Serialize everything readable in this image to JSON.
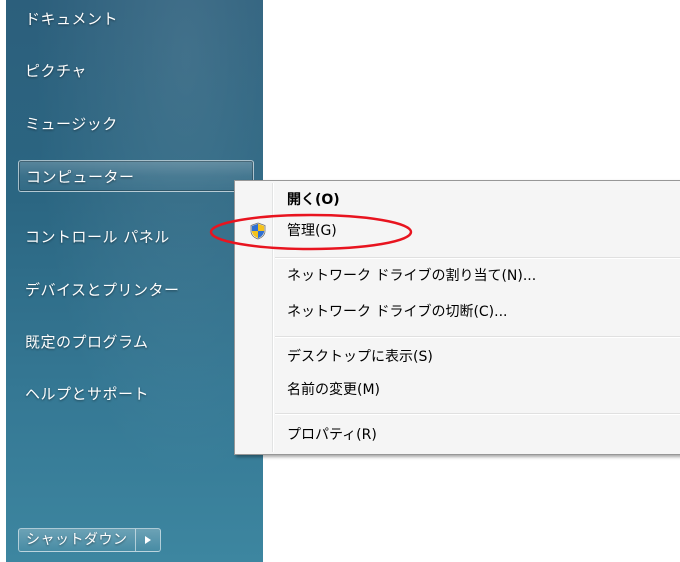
{
  "start_menu": {
    "items": [
      {
        "label": "ドキュメント"
      },
      {
        "label": "ピクチャ"
      },
      {
        "label": "ミュージック"
      },
      {
        "label": "コンピューター"
      },
      {
        "label": "コントロール パネル"
      },
      {
        "label": "デバイスとプリンター"
      },
      {
        "label": "既定のプログラム"
      },
      {
        "label": "ヘルプとサポート"
      }
    ],
    "shutdown_label": "シャットダウン",
    "shutdown_arrow_icon": "triangle-right-icon"
  },
  "context_menu": {
    "items": [
      {
        "label": "開く(O)"
      },
      {
        "label": "管理(G)",
        "icon": "uac-shield-icon"
      },
      {
        "label": "ネットワーク ドライブの割り当て(N)..."
      },
      {
        "label": "ネットワーク ドライブの切断(C)..."
      },
      {
        "label": "デスクトップに表示(S)"
      },
      {
        "label": "名前の変更(M)"
      },
      {
        "label": "プロパティ(R)"
      }
    ]
  },
  "colors": {
    "start_pane": "#2b6682",
    "menu_background": "#f5f5f5",
    "highlight_ellipse": "#e8141f"
  }
}
